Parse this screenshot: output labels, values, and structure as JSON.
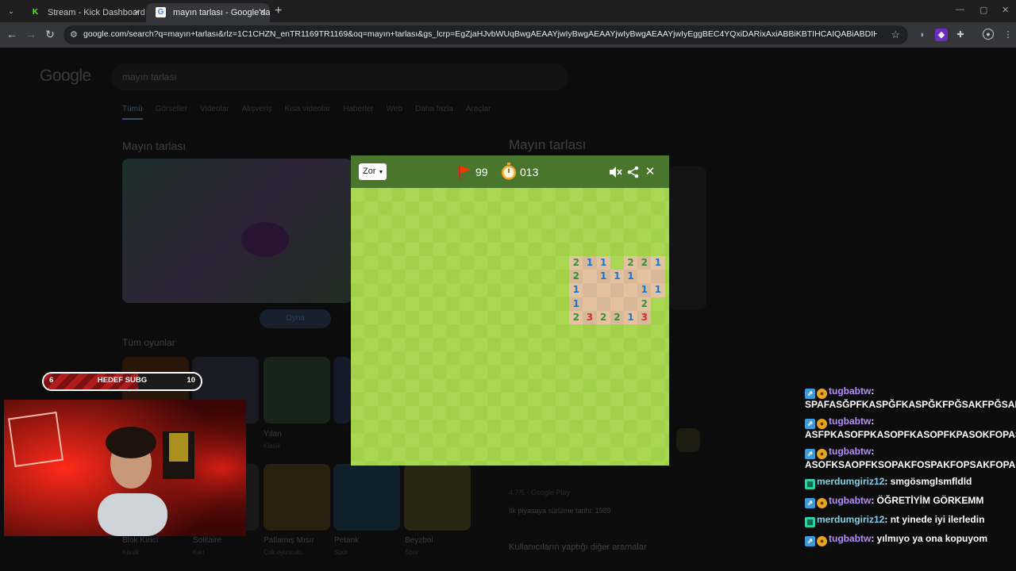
{
  "browser": {
    "tabs": [
      {
        "title": "Stream - Kick Dashboard",
        "favicon": "kick-icon",
        "close": "×"
      },
      {
        "title": "mayın tarlası - Google'da Ara",
        "favicon": "google-icon",
        "close": "×"
      }
    ],
    "new_tab": "+",
    "url": "google.com/search?q=mayın+tarlası&rlz=1C1CHZN_enTR1169TR1169&oq=mayın+tarlası&gs_lcrp=EgZjaHJvbWUqBwgAEAAYjwIyBwgAEAAYjwIyBwgAEAAYjwIyEggBEC4YQxiDARixAxiABBiKBTIHCAIQABiABDIHCAMQLhiABDIHCAQQABiABDIHCAUQABiABDIH..."
  },
  "google": {
    "logo": "Google",
    "query": "mayın tarlası",
    "tabs": [
      "Tümü",
      "Görseller",
      "Videolar",
      "Alışveriş",
      "Kısa videolar",
      "Haberler",
      "Web",
      "Daha fazla",
      "Araçlar"
    ],
    "left_title": "Mayın tarlası",
    "play_button": "Oyna",
    "all_games_title": "Tüm oyunlar",
    "games": [
      {
        "name": "Blok Kırıcı",
        "sub": "Klasik"
      },
      {
        "name": "Solitaire",
        "sub": "Kart"
      },
      {
        "name": "Yılan",
        "sub": "Klasik"
      },
      {
        "name": "Patlamış Mısır",
        "sub": "Çok oyunculu"
      },
      {
        "name": "Petank",
        "sub": "Spor"
      },
      {
        "name": "Beyzbol",
        "sub": "Spor"
      }
    ],
    "right_title": "Mayın tarlası",
    "rating": "4,7/5 · Google Play",
    "release_label": "İlk piyasaya sürülme tarihi:",
    "release_value": "1989",
    "related": "Kullanıcıların yaptığı diğer aramalar"
  },
  "minesweeper": {
    "difficulty": "Zor",
    "flags": "99",
    "timer": "013",
    "colors": {
      "header": "#4a752c",
      "n1": "#1976d2",
      "n2": "#388e3c",
      "n3": "#d32f2f"
    },
    "revealed": [
      {
        "r": 5,
        "c": 16,
        "v": "2"
      },
      {
        "r": 5,
        "c": 17,
        "v": "1"
      },
      {
        "r": 5,
        "c": 18,
        "v": "1"
      },
      {
        "r": 5,
        "c": 20,
        "v": "2"
      },
      {
        "r": 5,
        "c": 21,
        "v": "2"
      },
      {
        "r": 5,
        "c": 22,
        "v": "1"
      },
      {
        "r": 6,
        "c": 16,
        "v": "2"
      },
      {
        "r": 6,
        "c": 17,
        "v": ""
      },
      {
        "r": 6,
        "c": 18,
        "v": "1"
      },
      {
        "r": 6,
        "c": 19,
        "v": "1"
      },
      {
        "r": 6,
        "c": 20,
        "v": "1"
      },
      {
        "r": 6,
        "c": 21,
        "v": ""
      },
      {
        "r": 6,
        "c": 22,
        "v": ""
      },
      {
        "r": 7,
        "c": 16,
        "v": "1"
      },
      {
        "r": 7,
        "c": 17,
        "v": ""
      },
      {
        "r": 7,
        "c": 18,
        "v": ""
      },
      {
        "r": 7,
        "c": 19,
        "v": ""
      },
      {
        "r": 7,
        "c": 20,
        "v": ""
      },
      {
        "r": 7,
        "c": 21,
        "v": "1"
      },
      {
        "r": 7,
        "c": 22,
        "v": "1"
      },
      {
        "r": 8,
        "c": 16,
        "v": "1"
      },
      {
        "r": 8,
        "c": 17,
        "v": ""
      },
      {
        "r": 8,
        "c": 18,
        "v": ""
      },
      {
        "r": 8,
        "c": 19,
        "v": ""
      },
      {
        "r": 8,
        "c": 20,
        "v": ""
      },
      {
        "r": 8,
        "c": 21,
        "v": "2"
      },
      {
        "r": 9,
        "c": 16,
        "v": "2"
      },
      {
        "r": 9,
        "c": 17,
        "v": "3"
      },
      {
        "r": 9,
        "c": 18,
        "v": "2"
      },
      {
        "r": 9,
        "c": 19,
        "v": "2"
      },
      {
        "r": 9,
        "c": 20,
        "v": "1"
      },
      {
        "r": 9,
        "c": 21,
        "v": "3"
      }
    ]
  },
  "goal": {
    "current": "6",
    "label": "HEDEF SUBG",
    "target": "10",
    "progress": 0.6
  },
  "chat": [
    {
      "user": "tugbabtw",
      "text": "SPAFASĞPFKASPĞFKASPĞKFPĞSAKFPĞSAKF",
      "badges": [
        "bot",
        "coin"
      ],
      "wrap": true,
      "color": "purple"
    },
    {
      "user": "tugbabtw",
      "text": "ASFPKASOFPKASOPFKASOPFKPASOKFOPASF",
      "badges": [
        "bot",
        "coin"
      ],
      "wrap": true,
      "color": "purple"
    },
    {
      "user": "tugbabtw",
      "text": "ASOFKSAOPFKSOPAKFOSPAKFOPSAKFOPASK",
      "badges": [
        "bot",
        "coin"
      ],
      "wrap": true,
      "color": "purple"
    },
    {
      "user": "merdumgiriz12",
      "text": "smgösmglsmfldld",
      "badges": [
        "gift"
      ],
      "wrap": false,
      "color": "teal"
    },
    {
      "user": "tugbabtw",
      "text": "ÖĞRETİYİM GÖRKEMM",
      "badges": [
        "bot",
        "coin"
      ],
      "wrap": false,
      "color": "purple"
    },
    {
      "user": "merdumgiriz12",
      "text": "nt yinede iyi ilerledin",
      "badges": [
        "gift"
      ],
      "wrap": false,
      "color": "teal"
    },
    {
      "user": "tugbabtw",
      "text": "yılmıyo ya ona kopuyom",
      "badges": [
        "bot",
        "coin"
      ],
      "wrap": false,
      "color": "purple"
    }
  ]
}
